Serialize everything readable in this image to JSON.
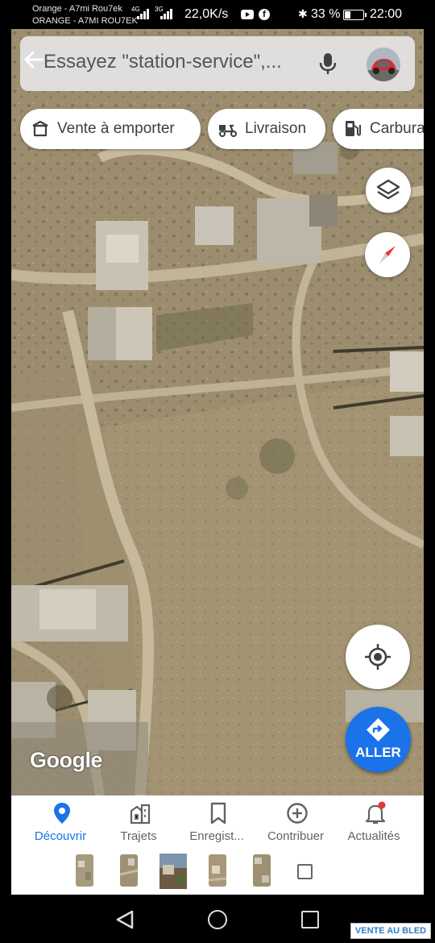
{
  "status_bar": {
    "carrier_line1": "Orange - A7mi Rou7ek",
    "carrier_line2": "ORANGE - A7MI ROU7EK",
    "network_type": "4G 3G",
    "net_speed": "22,0K/s",
    "battery_percent": "33 %",
    "battery_level": 0.33,
    "time": "22:00",
    "icons": [
      "signal-icon",
      "youtube-icon",
      "facebook-icon",
      "bluetooth-icon",
      "battery-icon"
    ]
  },
  "search": {
    "placeholder": "Essayez \"station-service\",...",
    "back_icon": "back-arrow-icon",
    "mic_icon": "mic-icon",
    "avatar": "profile-avatar"
  },
  "chips": [
    {
      "label": "Vente à emporter",
      "icon": "takeout-bag-icon"
    },
    {
      "label": "Livraison",
      "icon": "delivery-scooter-icon"
    },
    {
      "label": "Carbura",
      "icon": "fuel-pump-icon"
    }
  ],
  "map_controls": {
    "layers_icon": "layers-icon",
    "compass_icon": "compass-icon",
    "locate_icon": "my-location-icon",
    "go_label": "ALLER",
    "go_icon": "directions-icon",
    "colors": {
      "accent": "#1a73e8",
      "compass_red": "#e53935"
    }
  },
  "map": {
    "logo": "Google",
    "type": "satellite"
  },
  "bottom_nav": {
    "items": [
      {
        "label": "Découvrir",
        "icon": "explore-pin-icon",
        "active": true
      },
      {
        "label": "Trajets",
        "icon": "commute-icon",
        "active": false
      },
      {
        "label": "Enregist...",
        "icon": "bookmark-icon",
        "active": false
      },
      {
        "label": "Contribuer",
        "icon": "add-circle-icon",
        "active": false
      },
      {
        "label": "Actualités",
        "icon": "bell-icon",
        "active": false,
        "badge": true
      }
    ]
  },
  "recents": {
    "count_thumbnails": 5,
    "square_icon": "recent-apps-square-icon"
  },
  "system_nav": {
    "back_icon": "triangle-back-icon",
    "home_icon": "circle-home-icon",
    "recents_icon": "square-recents-icon"
  },
  "watermark": "VENTE AU BLED"
}
